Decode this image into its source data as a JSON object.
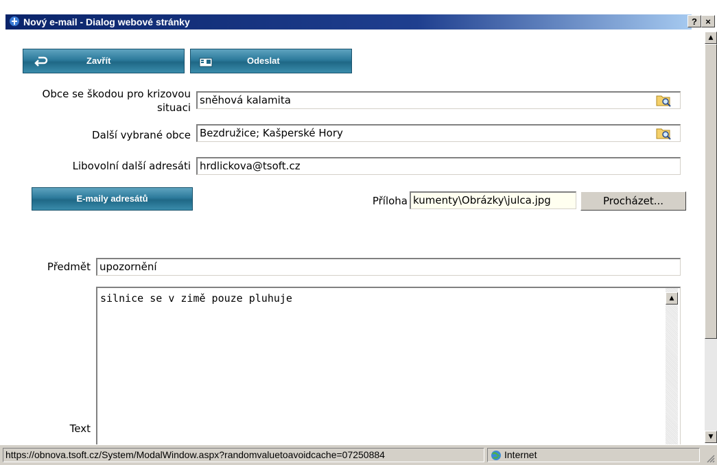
{
  "window": {
    "title": "Nový e-mail - Dialog webové stránky",
    "help_label": "?",
    "close_label": "×"
  },
  "toolbar": {
    "close_label": "Zavřít",
    "send_label": "Odeslat"
  },
  "form": {
    "obce_label": "Obce se škodou pro krizovou situaci",
    "obce_value": "sněhová kalamita",
    "dalsi_obce_label": "Další vybrané obce",
    "dalsi_obce_value": "Bezdružice; Kašperské Hory",
    "adresati_label": "Libovolní další adresáti",
    "adresati_value": "hrdlickova@tsoft.cz",
    "emails_button": "E-maily adresátů",
    "priloha_label": "Příloha",
    "priloha_value": "kumenty\\Obrázky\\julca.jpg",
    "browse_button": "Procházet...",
    "predmet_label": "Předmět",
    "predmet_value": "upozornění",
    "text_label": "Text",
    "text_value": "silnice se v zimě pouze pluhuje"
  },
  "statusbar": {
    "url": "https://obnova.tsoft.cz/System/ModalWindow.aspx?randomvaluetoavoidcache=07250884",
    "zone": "Internet"
  }
}
